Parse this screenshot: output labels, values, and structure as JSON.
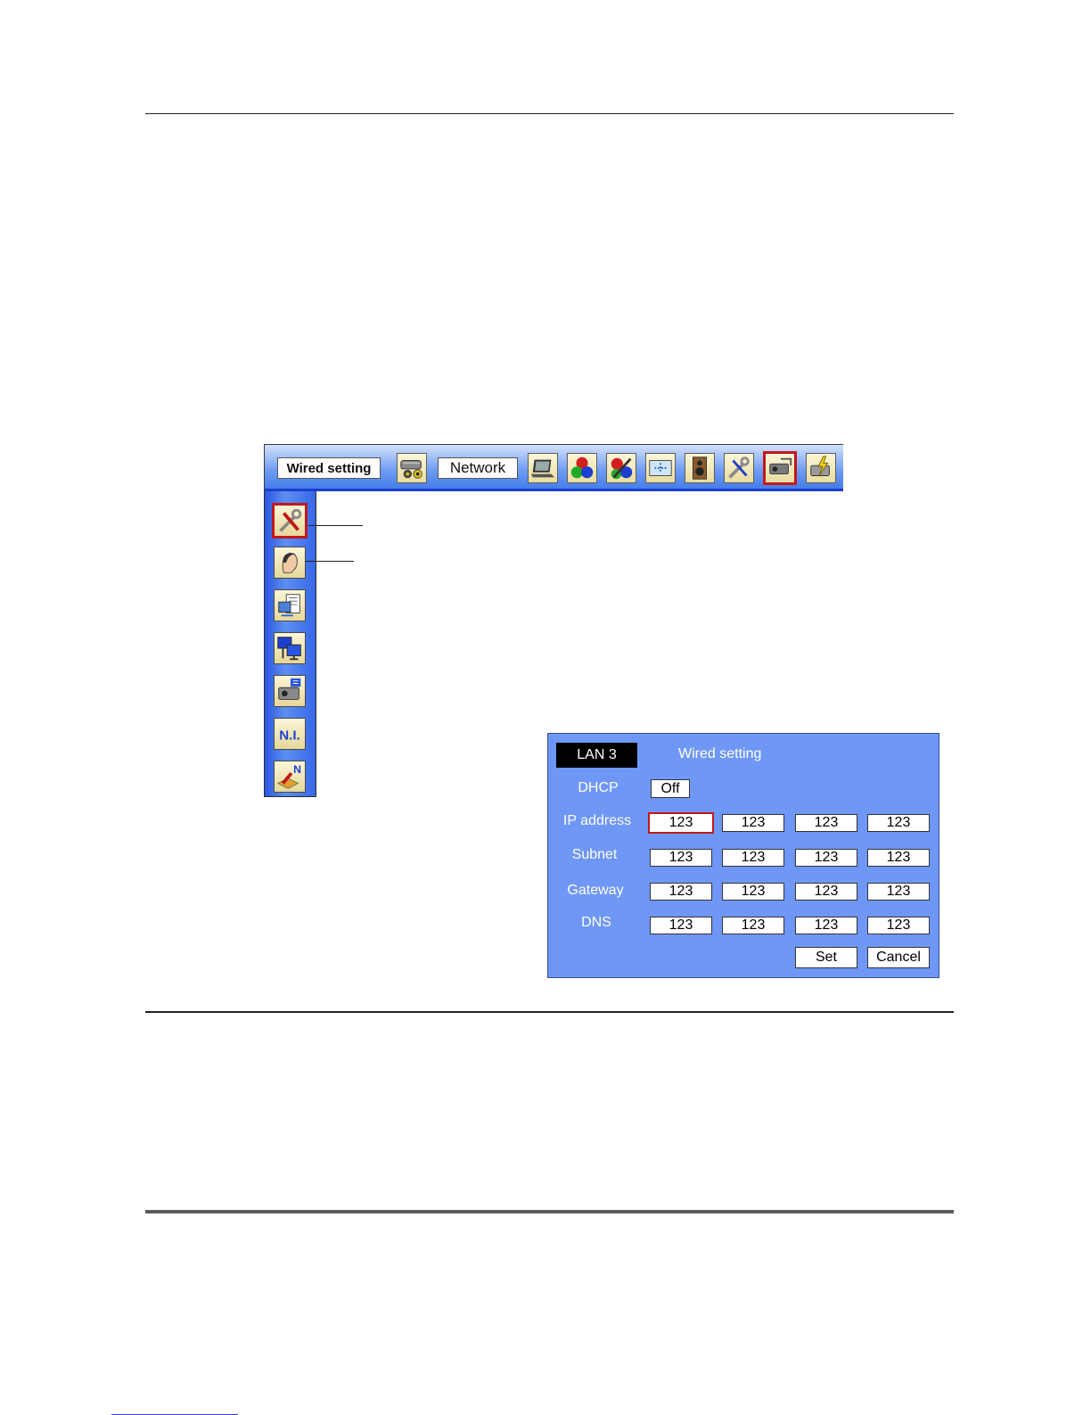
{
  "menubar": {
    "wired_label": "Wired setting",
    "network_label": "Network",
    "icons": [
      "network-camera-icon",
      "laptop-icon",
      "color-balls-icon",
      "color-adjust-icon",
      "screen-icon",
      "speaker-icon",
      "setting-tools-icon",
      "projector-network-icon",
      "projector-power-icon"
    ],
    "selected_icon": "projector-network-icon"
  },
  "sidebar": {
    "icons": [
      "wired-setting-icon",
      "network-user-icon",
      "network-info-icon",
      "lan-monitor-icon",
      "projector-ip-icon",
      "ni-icon",
      "network-factory-default-icon"
    ],
    "selected_icon": "wired-setting-icon",
    "ni_text": "N.I.",
    "n_text": "N"
  },
  "dialog": {
    "badge": "LAN 3",
    "title": "Wired setting",
    "dhcp_label": "DHCP",
    "dhcp_value": "Off",
    "rows": [
      {
        "label": "IP address",
        "values": [
          "123",
          "123",
          "123",
          "123"
        ]
      },
      {
        "label": "Subnet",
        "values": [
          "123",
          "123",
          "123",
          "123"
        ]
      },
      {
        "label": "Gateway",
        "values": [
          "123",
          "123",
          "123",
          "123"
        ]
      },
      {
        "label": "DNS",
        "values": [
          "123",
          "123",
          "123",
          "123"
        ]
      }
    ],
    "set_label": "Set",
    "cancel_label": "Cancel"
  },
  "colors": {
    "selection": "#c1171b",
    "menu_blue": "#3f78ea",
    "dialog_blue": "#6f97f5"
  }
}
